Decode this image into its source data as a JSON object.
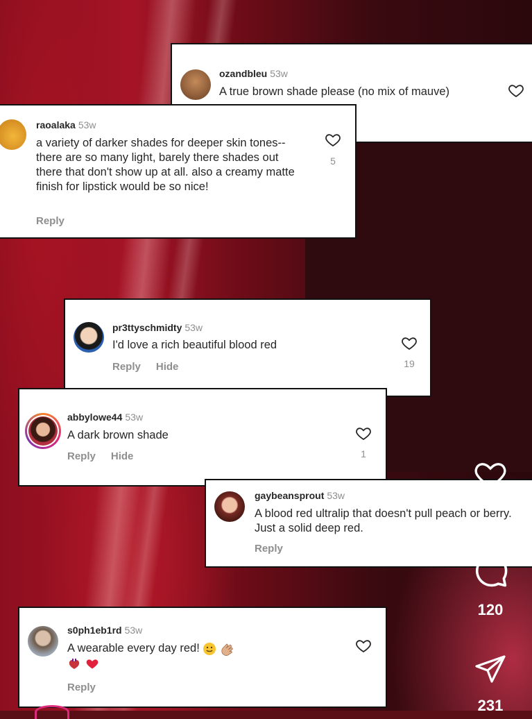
{
  "comments": [
    {
      "username": "ozandbleu",
      "time": "53w",
      "text": "A true brown shade please (no mix of mauve)"
    },
    {
      "username": "raoalaka",
      "time": "53w",
      "text": "a variety of darker shades for deeper skin tones--there are so many light, barely there shades out there that don't show up at all. also a creamy matte finish for lipstick would be so nice!",
      "reply_label": "Reply",
      "likes": "5"
    },
    {
      "username": "pr3ttyschmidty",
      "time": "53w",
      "text": "I'd love a rich beautiful blood red",
      "reply_label": "Reply",
      "hide_label": "Hide",
      "likes": "19"
    },
    {
      "username": "abbylowe44",
      "time": "53w",
      "text": "A dark brown shade",
      "reply_label": "Reply",
      "hide_label": "Hide",
      "likes": "1"
    },
    {
      "username": "gaybeansprout",
      "time": "53w",
      "text": "A blood red ultralip that doesn't pull peach or berry. Just a solid deep red.",
      "reply_label": "Reply"
    },
    {
      "username": "s0ph1eb1rd",
      "time": "53w",
      "text": "A wearable every day red!",
      "reply_label": "Reply"
    }
  ],
  "sidebar": {
    "likes_count": "",
    "comments_count": "120",
    "shares_count": "231"
  },
  "colors": {
    "accent_red": "#e2203b",
    "text_gray": "#8e8e8e"
  },
  "icons": [
    "heart-icon",
    "comment-icon",
    "send-icon"
  ]
}
